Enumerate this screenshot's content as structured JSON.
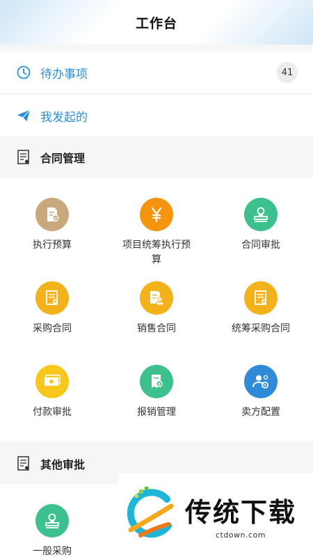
{
  "header": {
    "title": "工作台"
  },
  "todo": {
    "label": "待办事项",
    "count": "41"
  },
  "mine": {
    "label": "我发起的"
  },
  "contract_section": {
    "title": "合同管理",
    "items": [
      {
        "label": "执行预算",
        "icon": "document-check-icon",
        "color": "#c8a87c"
      },
      {
        "label": "项目统筹执行预算",
        "icon": "yen-icon",
        "color": "#f5940f"
      },
      {
        "label": "合同审批",
        "icon": "stamp-icon",
        "color": "#3cc08e"
      },
      {
        "label": "采购合同",
        "icon": "document-icon",
        "color": "#f4b21a"
      },
      {
        "label": "销售合同",
        "icon": "document-stamp-icon",
        "color": "#f4b21a"
      },
      {
        "label": "统筹采购合同",
        "icon": "document-icon",
        "color": "#f4b21a"
      },
      {
        "label": "付款审批",
        "icon": "money-icon",
        "color": "#f7c81b"
      },
      {
        "label": "报销管理",
        "icon": "receipt-icon",
        "color": "#3cc08e"
      },
      {
        "label": "卖方配置",
        "icon": "user-gear-icon",
        "color": "#2f8bd8"
      }
    ]
  },
  "other_section": {
    "title": "其他审批",
    "items": [
      {
        "label": "一般采购",
        "icon": "stamp-icon",
        "color": "#3cc08e"
      }
    ]
  },
  "watermark": {
    "title": "传统下载",
    "url": "ctdown.com"
  }
}
